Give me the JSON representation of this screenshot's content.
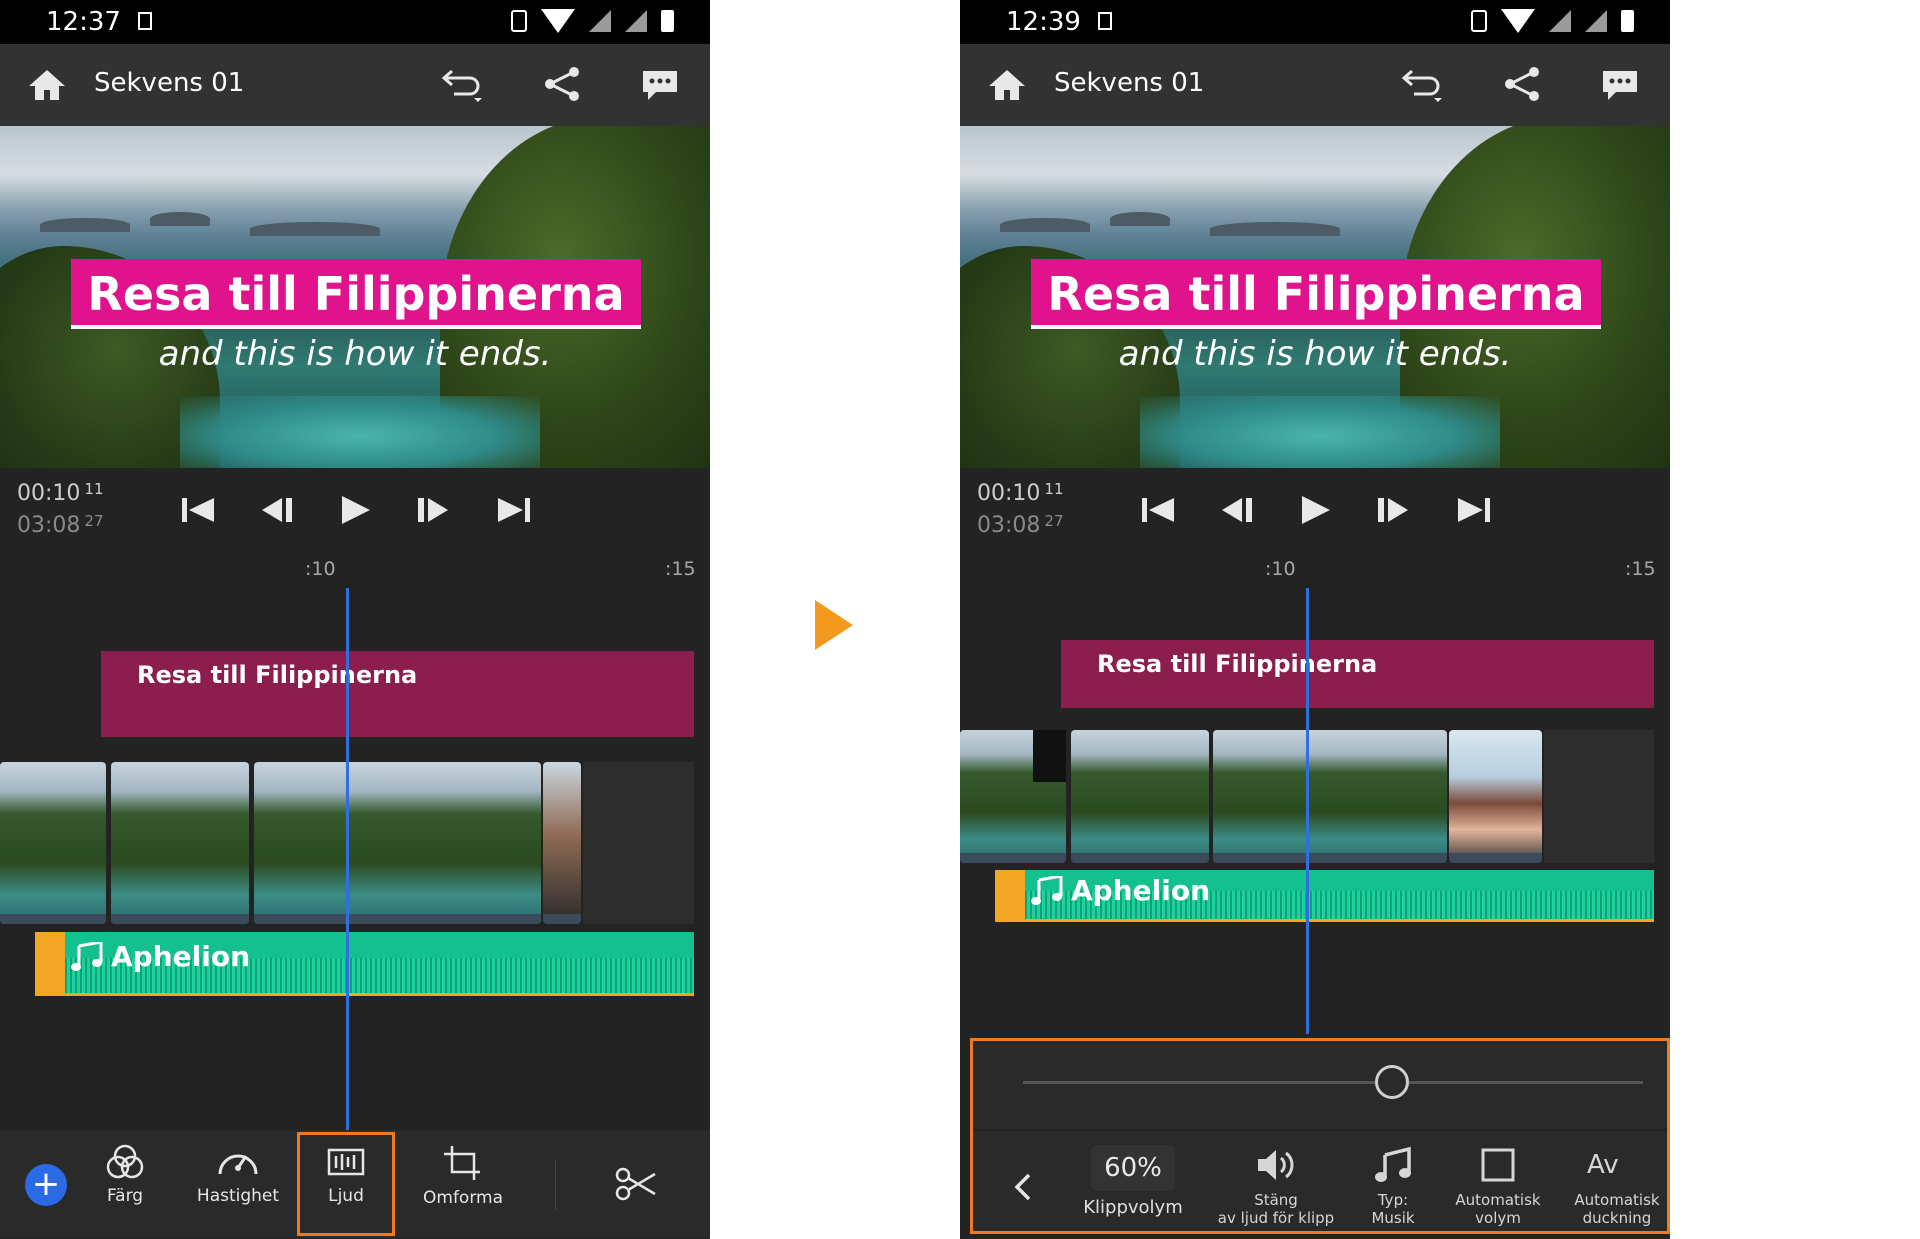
{
  "status_left": {
    "time": "12:37"
  },
  "status_right": {
    "time": "12:39"
  },
  "header": {
    "title": "Sekvens 01"
  },
  "preview": {
    "title": "Resa till Filippinerna",
    "subtitle": "and this is how it ends."
  },
  "timecode": {
    "current": "00:10",
    "current_frames": "11",
    "total": "03:08",
    "total_frames": "27"
  },
  "ruler": {
    "mark_10": ":10",
    "mark_15": ":15"
  },
  "tracks": {
    "title_clip": "Resa till Filippinerna",
    "audio_clip": "Aphelion"
  },
  "toolbar": {
    "add": "+",
    "farg": "Färg",
    "hastighet": "Hastighet",
    "ljud": "Ljud",
    "omforma": "Omforma"
  },
  "volume_panel": {
    "level_percent": 60,
    "level_label": "60%",
    "klippvolym": "Klippvolym",
    "mute_line1": "Stäng",
    "mute_line2": "av ljud för klipp",
    "type_line1": "Typ:",
    "type_line2": "Musik",
    "auto_volume_line1": "Automatisk",
    "auto_volume_line2": "volym",
    "auto_ducking_icon": "Av",
    "auto_ducking_line1": "Automatisk",
    "auto_ducking_line2": "duckning"
  },
  "colors": {
    "accent_orange": "#f07a22",
    "title_pink": "#e0138c",
    "title_track": "#8c1e4d",
    "audio_green": "#13c08e",
    "audio_orange": "#f3a623",
    "playhead_blue": "#2f6fe0",
    "add_blue": "#2a6ae4"
  }
}
